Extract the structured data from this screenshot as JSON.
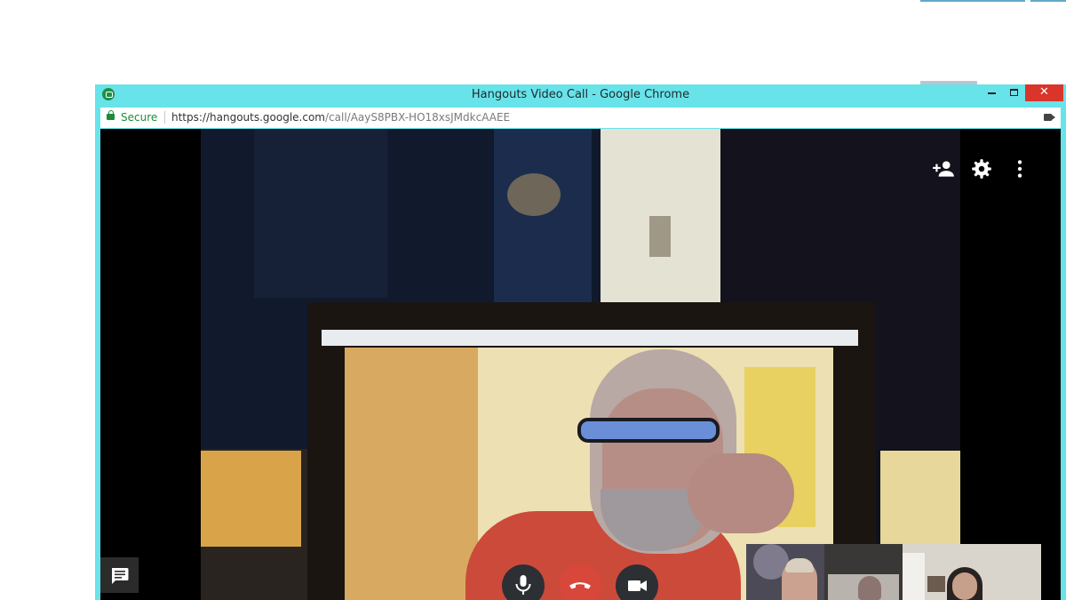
{
  "window": {
    "title": "Hangouts Video Call - Google Chrome",
    "chrome_color": "#68e3ea",
    "close_color": "#d9352b"
  },
  "address_bar": {
    "secure_label": "Secure",
    "url_host": "https://hangouts.google.com",
    "url_path": "/call/AayS8PBX-HO18xsJMdkcAAEE"
  },
  "call": {
    "top_controls": [
      "add-person-icon",
      "gear-icon",
      "more-vert-icon"
    ],
    "bottom_controls": [
      "microphone-icon",
      "hangup-icon",
      "camera-icon"
    ],
    "chat_icon": "chat-icon",
    "hangup_color": "#d7473a",
    "participant_thumbnails": 3
  }
}
